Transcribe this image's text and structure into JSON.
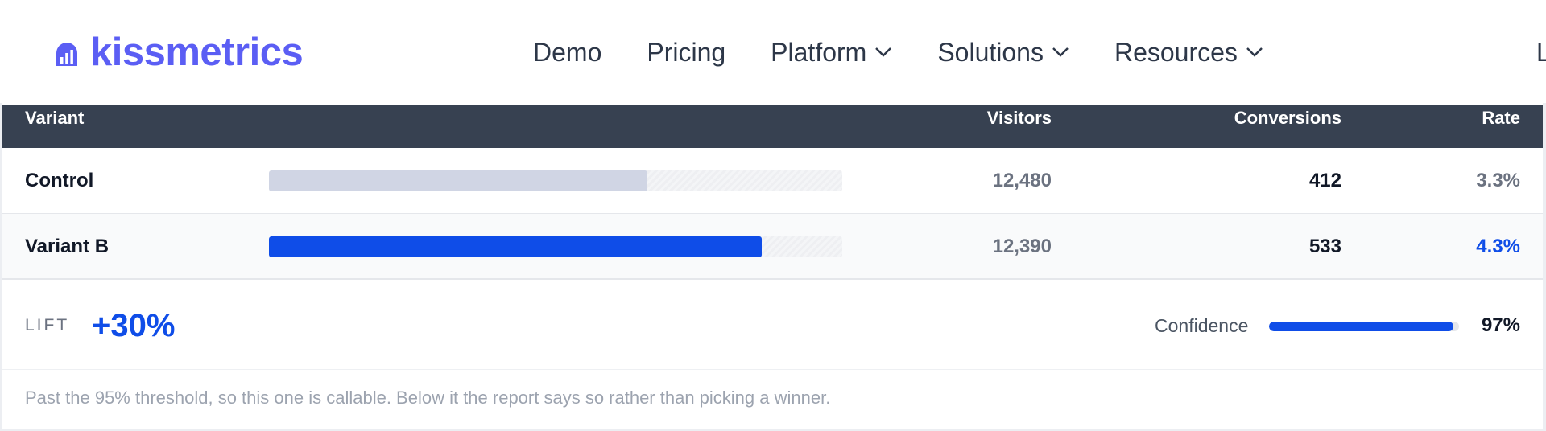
{
  "brand": {
    "name": "kissmetrics",
    "icon": "kissmetrics-logo-icon",
    "color": "#5b5ef4"
  },
  "nav": {
    "items": [
      {
        "label": "Demo",
        "dropdown": false
      },
      {
        "label": "Pricing",
        "dropdown": false
      },
      {
        "label": "Platform",
        "dropdown": true
      },
      {
        "label": "Solutions",
        "dropdown": true
      },
      {
        "label": "Resources",
        "dropdown": true
      }
    ],
    "cut_off_label": "L"
  },
  "table": {
    "headers": {
      "variant": "Variant",
      "visitors": "Visitors",
      "conversions": "Conversions",
      "rate": "Rate"
    },
    "rows": [
      {
        "name": "Control",
        "visitors": "12,480",
        "conversions": "412",
        "rate": "3.3%",
        "bar_fraction": 0.66,
        "bar_color": "#d0d5e4"
      },
      {
        "name": "Variant B",
        "visitors": "12,390",
        "conversions": "533",
        "rate": "4.3%",
        "bar_fraction": 0.86,
        "bar_color": "#0f4de8"
      }
    ]
  },
  "summary": {
    "lift_label": "LIFT",
    "lift_value": "+30%",
    "confidence_label": "Confidence",
    "confidence_value": "97%",
    "confidence_fraction": 0.97
  },
  "note": "Past the 95% threshold, so this one is callable. Below it the report says so rather than picking a winner.",
  "colors": {
    "accent": "#0f4de8",
    "header_bg": "#374151"
  }
}
